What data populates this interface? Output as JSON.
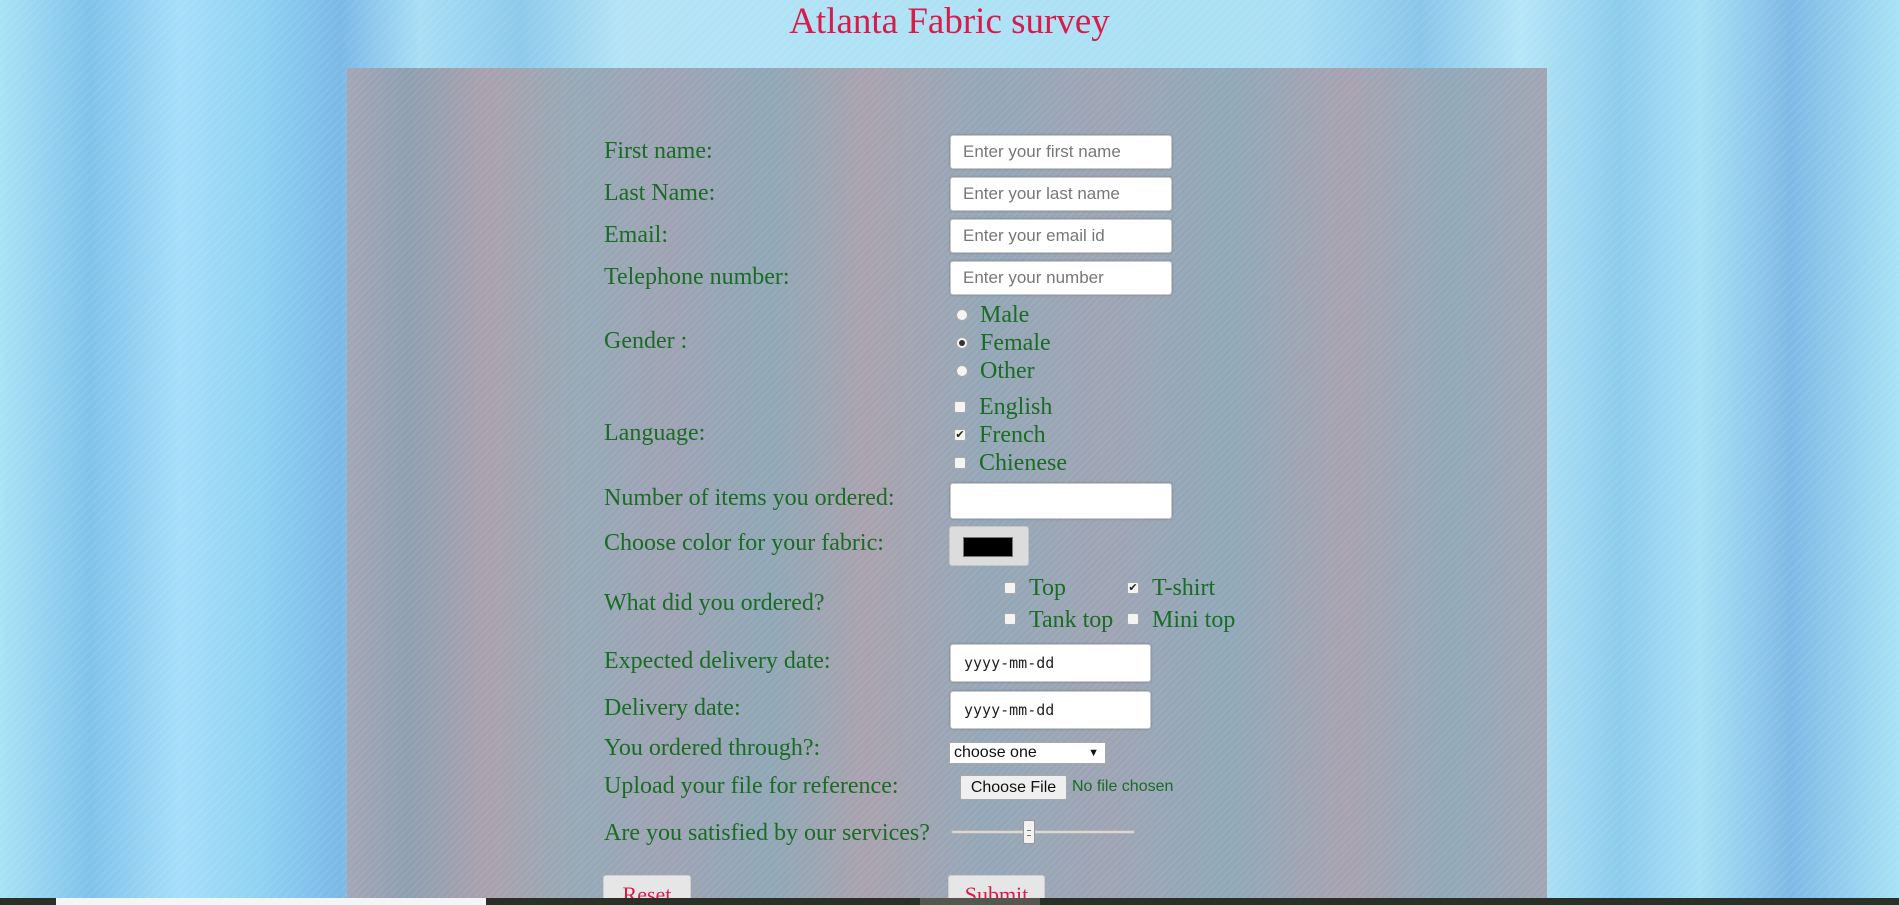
{
  "page": {
    "title": "Atlanta Fabric survey"
  },
  "form": {
    "first_name": {
      "label": "First name:",
      "placeholder": "Enter your first name",
      "value": ""
    },
    "last_name": {
      "label": "Last Name:",
      "placeholder": "Enter your last name",
      "value": ""
    },
    "email": {
      "label": "Email:",
      "placeholder": "Enter your email id",
      "value": ""
    },
    "telephone": {
      "label": "Telephone number:",
      "placeholder": "Enter your number",
      "value": ""
    },
    "gender": {
      "label": "Gender :",
      "options": [
        "Male",
        "Female",
        "Other"
      ],
      "selected": "Female"
    },
    "language": {
      "label": "Language:",
      "options": [
        "English",
        "French",
        "Chienese"
      ],
      "checked": [
        "French"
      ]
    },
    "items_count": {
      "label": "Number of items you ordered:",
      "value": ""
    },
    "fabric_color": {
      "label": "Choose color for your fabric:",
      "value": "#000000"
    },
    "ordered": {
      "label": "What did you ordered?",
      "options": [
        "Top",
        "T-shirt",
        "Tank top",
        "Mini top"
      ],
      "checked": [
        "T-shirt"
      ]
    },
    "expected_delivery": {
      "label": "Expected delivery date:",
      "placeholder": "yyyy-mm-dd"
    },
    "delivery": {
      "label": "Delivery date:",
      "placeholder": "yyyy-mm-dd"
    },
    "ordered_through": {
      "label": "You ordered through?:",
      "selected": "choose one"
    },
    "upload": {
      "label": "Upload your file for reference:",
      "button": "Choose File",
      "status": "No file chosen"
    },
    "satisfaction": {
      "label": "Are you satisfied by our services?",
      "value": 0.42
    },
    "reset_label": "Reset",
    "submit_label": "Submit"
  },
  "icons": {
    "select_arrow": "chevron-down-icon",
    "check": "checkmark-icon"
  },
  "colors": {
    "title": "#d81b4a",
    "label": "#1a6b24",
    "button_text": "#d81b4a"
  }
}
